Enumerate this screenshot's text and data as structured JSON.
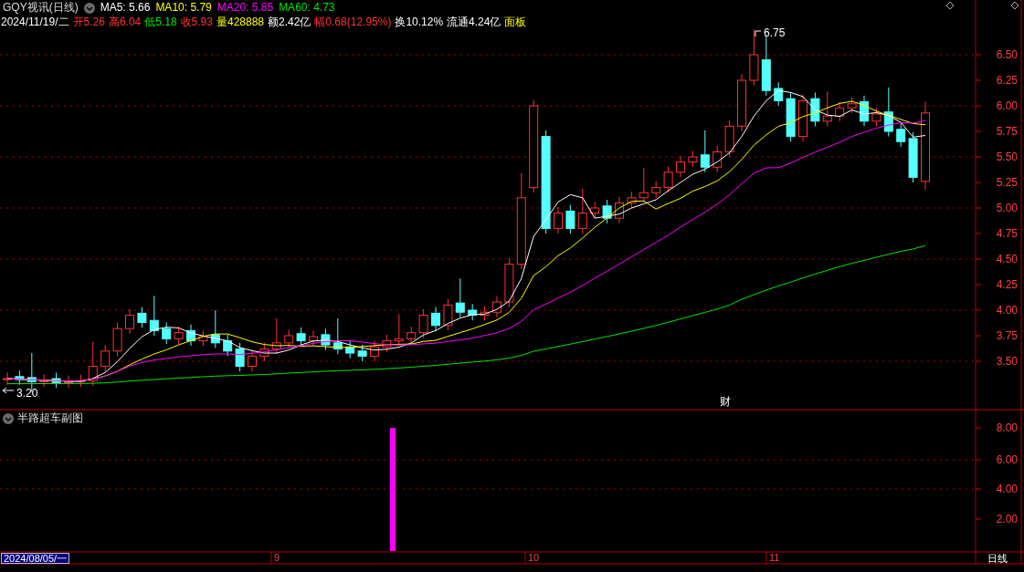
{
  "header": {
    "title": "GQY视讯(日线)",
    "ma": [
      {
        "label": "MA5: 5.66",
        "color": "#ffffff"
      },
      {
        "label": "MA10: 5.79",
        "color": "#ffff00"
      },
      {
        "label": "MA20: 5.85",
        "color": "#ff00ff"
      },
      {
        "label": "MA60: 4.73",
        "color": "#00e600"
      }
    ]
  },
  "quote": [
    {
      "text": "2024/11/19/二",
      "color": "#ffffff"
    },
    {
      "text": "开5.26",
      "color": "#ff3232"
    },
    {
      "text": "高6.04",
      "color": "#ff3232"
    },
    {
      "text": "低5.18",
      "color": "#00e600"
    },
    {
      "text": "收5.93",
      "color": "#ff3232"
    },
    {
      "text": "量428888",
      "color": "#ffff00"
    },
    {
      "text": "额2.42亿",
      "color": "#ffffff"
    },
    {
      "text": "幅0.68(12.95%)",
      "color": "#ff3232"
    },
    {
      "text": "换10.12%",
      "color": "#ffffff"
    },
    {
      "text": "流通4.24亿",
      "color": "#ffffff"
    },
    {
      "text": "面板",
      "color": "#ffff00"
    }
  ],
  "price_axis": {
    "ticks": [
      "6.50",
      "6.25",
      "6.00",
      "5.75",
      "5.50",
      "5.25",
      "5.00",
      "4.75",
      "4.50",
      "4.25",
      "4.00",
      "3.75",
      "3.50"
    ]
  },
  "markers": {
    "high": "6.75",
    "low": "3.20",
    "event": "财"
  },
  "sub_chart": {
    "title": "半路超车副图",
    "ticks": [
      "8.00",
      "6.00",
      "4.00",
      "2.00"
    ]
  },
  "time_axis": {
    "start": "2024/08/05/一",
    "months": [
      "9",
      "10",
      "11"
    ],
    "period": "日线"
  }
}
